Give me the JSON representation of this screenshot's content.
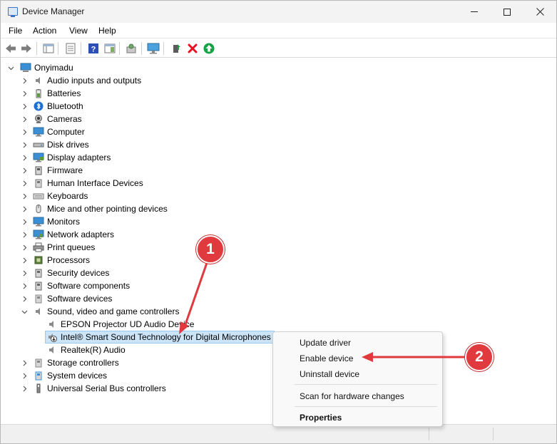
{
  "window": {
    "title": "Device Manager",
    "minimize_icon": "minimize-icon",
    "maximize_icon": "maximize-icon",
    "close_icon": "close-icon"
  },
  "menu": [
    "File",
    "Action",
    "View",
    "Help"
  ],
  "toolbar": {
    "buttons": [
      "back-arrow-icon",
      "forward-arrow-icon",
      "show-hide-tree-icon",
      "properties-icon",
      "help-icon",
      "action-pane-icon",
      "scan-hardware-icon",
      "monitor-icon",
      "update-driver-icon",
      "uninstall-icon",
      "enable-device-icon"
    ],
    "colors": {
      "uninstall": "#e81123",
      "enable": "#17a345"
    }
  },
  "tree": {
    "root": "Onyimadu",
    "categories": [
      {
        "label": "Audio inputs and outputs",
        "icon": "speaker-icon"
      },
      {
        "label": "Batteries",
        "icon": "battery-icon"
      },
      {
        "label": "Bluetooth",
        "icon": "bluetooth-icon"
      },
      {
        "label": "Cameras",
        "icon": "camera-icon"
      },
      {
        "label": "Computer",
        "icon": "computer-icon"
      },
      {
        "label": "Disk drives",
        "icon": "disk-drive-icon"
      },
      {
        "label": "Display adapters",
        "icon": "display-adapter-icon"
      },
      {
        "label": "Firmware",
        "icon": "firmware-icon"
      },
      {
        "label": "Human Interface Devices",
        "icon": "hid-icon"
      },
      {
        "label": "Keyboards",
        "icon": "keyboard-icon"
      },
      {
        "label": "Mice and other pointing devices",
        "icon": "mouse-icon"
      },
      {
        "label": "Monitors",
        "icon": "monitor-icon"
      },
      {
        "label": "Network adapters",
        "icon": "network-adapter-icon"
      },
      {
        "label": "Print queues",
        "icon": "printer-icon"
      },
      {
        "label": "Processors",
        "icon": "processor-icon"
      },
      {
        "label": "Security devices",
        "icon": "security-device-icon"
      },
      {
        "label": "Software components",
        "icon": "software-component-icon"
      },
      {
        "label": "Software devices",
        "icon": "software-device-icon"
      },
      {
        "label": "Sound, video and game controllers",
        "icon": "speaker-icon"
      }
    ],
    "sound_children": [
      {
        "label": "EPSON Projector UD Audio Device",
        "icon": "speaker-icon"
      },
      {
        "label": "Intel® Smart Sound Technology for Digital Microphones",
        "icon": "disabled-device-icon"
      },
      {
        "label": "Realtek(R) Audio",
        "icon": "speaker-icon"
      }
    ],
    "after": [
      {
        "label": "Storage controllers",
        "icon": "storage-controller-icon"
      },
      {
        "label": "System devices",
        "icon": "system-device-icon"
      },
      {
        "label": "Universal Serial Bus controllers",
        "icon": "usb-icon"
      }
    ]
  },
  "context_menu": {
    "items": [
      "Update driver",
      "Enable device",
      "Uninstall device",
      "Scan for hardware changes",
      "Properties"
    ]
  },
  "annotations": {
    "badge1": "1",
    "badge2": "2",
    "color": "#e0393e"
  }
}
